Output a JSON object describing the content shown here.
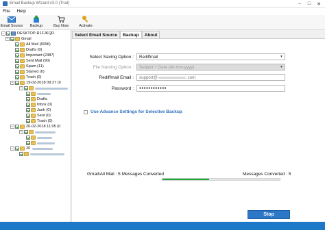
{
  "window": {
    "title": "Email Backup Wizard v3.0 (Trial)"
  },
  "menu": [
    "File",
    "Help"
  ],
  "toolbar": [
    {
      "label": "Email Source",
      "icon": "envelope-icon"
    },
    {
      "label": "Backup",
      "icon": "backup-icon"
    },
    {
      "label": "Buy Now",
      "icon": "cart-icon"
    },
    {
      "label": "Activate",
      "icon": "key-icon"
    }
  ],
  "tree": {
    "root": "DESKTOP-R1FJKQR",
    "account": "Gmail",
    "folders": [
      "All Mail (6096)",
      "Drafts (0)",
      "Important (2387)",
      "Sent Mail (90)",
      "Spam (11)",
      "Starred (0)",
      "Trash (0)"
    ],
    "dates": [
      "19-02-2018 09:27 (0",
      "20-02-2018 11:05 (0",
      "20"
    ],
    "subfolders": [
      "Drafts",
      "Inbox (0)",
      "Junk (0)",
      "Sent (0)",
      "Trash (0)"
    ]
  },
  "tabs": [
    "Select Email Source",
    "Backup",
    "About"
  ],
  "form": {
    "saving_option_label": "Select Saving Option :",
    "saving_option_value": "Rediffmail",
    "naming_option_label": "File Naming Option :",
    "naming_option_value": "Subject + Date (dd-mm-yyyy)",
    "email_label": "Rediffmail Email :",
    "email_value": "support@",
    "email_suffix": ".com",
    "password_label": "Password :",
    "password_value": "●●●●●●●●●●●●"
  },
  "advance_label": "Use Advance Settings for Selective Backup",
  "status": {
    "left": "Gmail\\All Mail : 5 Messages Converted",
    "right": "Messages Converted : 5",
    "progress": 0.4
  },
  "stop_label": "Stop",
  "colors": {
    "accent": "#2d77c7",
    "progress": "#1fa83a",
    "link": "#2c6ebd"
  }
}
